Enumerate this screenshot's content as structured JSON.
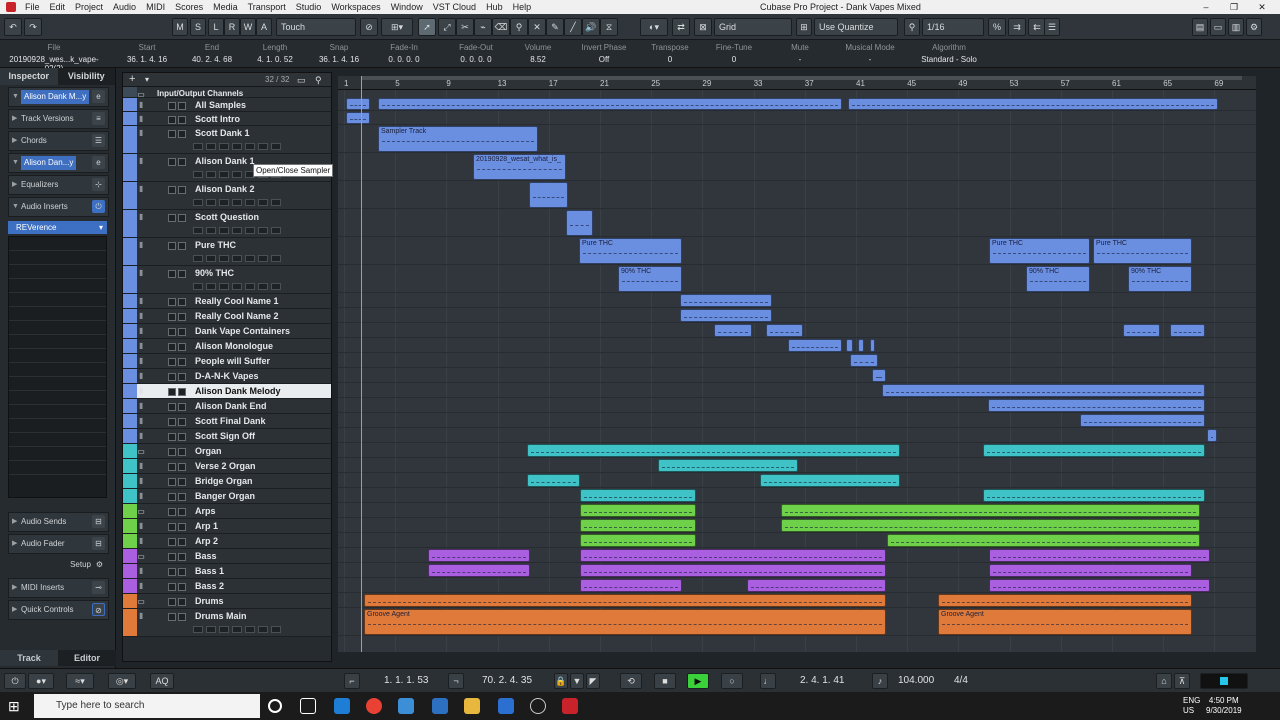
{
  "window": {
    "title": "Cubase Pro Project - Dank Vapes Mixed",
    "menus": [
      "File",
      "Edit",
      "Project",
      "Audio",
      "MIDI",
      "Scores",
      "Media",
      "Transport",
      "Studio",
      "Workspaces",
      "Window",
      "VST Cloud",
      "Hub",
      "Help"
    ]
  },
  "toolbar": {
    "m": "M",
    "s": "S",
    "l": "L",
    "r": "R",
    "w": "W",
    "a": "A",
    "automation_mode": "Touch",
    "grid_type": "Grid",
    "quantize_mode": "Use Quantize",
    "quantize_value": "1/16"
  },
  "infoline": [
    {
      "label": "File",
      "value": "20190928_wes...k_vape-02(2)"
    },
    {
      "label": "Start",
      "value": "36. 1. 4. 16"
    },
    {
      "label": "End",
      "value": "40. 2. 4. 68"
    },
    {
      "label": "Length",
      "value": "4. 1. 0. 52"
    },
    {
      "label": "Snap",
      "value": "36. 1. 4. 16"
    },
    {
      "label": "Fade-In",
      "value": "0. 0. 0. 0"
    },
    {
      "label": "Fade-Out",
      "value": "0. 0. 0. 0"
    },
    {
      "label": "Volume",
      "value": "8.52"
    },
    {
      "label": "Invert Phase",
      "value": "Off"
    },
    {
      "label": "Transpose",
      "value": "0"
    },
    {
      "label": "Fine-Tune",
      "value": "0"
    },
    {
      "label": "Mute",
      "value": "-"
    },
    {
      "label": "Musical Mode",
      "value": "-"
    },
    {
      "label": "Algorithm",
      "value": "Standard - Solo"
    }
  ],
  "inspector": {
    "tabs": [
      "Inspector",
      "Visibility"
    ],
    "track_name": "Alison Dank M...y",
    "track_versions": "Track Versions",
    "chords": "Chords",
    "sub_track": "Alison Dan...y",
    "equalizers": "Equalizers",
    "audio_inserts": "Audio Inserts",
    "insert_plugin": "REVerence",
    "audio_sends": "Audio Sends",
    "audio_fader": "Audio Fader",
    "setup": "Setup",
    "midi_inserts": "MIDI Inserts",
    "quick_controls": "Quick Controls",
    "bottom_tabs": [
      "Track",
      "Editor"
    ]
  },
  "tracklist": {
    "count": "32 / 32",
    "tooltip": "Open/Close Sampler"
  },
  "tracks": [
    {
      "name": "Input/Output Channels",
      "color": "#3d4a57"
    },
    {
      "name": "All Samples",
      "color": "#6b8fe0"
    },
    {
      "name": "Scott Intro",
      "color": "#6b8fe0"
    },
    {
      "name": "Scott Dank 1",
      "color": "#6b8fe0"
    },
    {
      "name": "Alison Dank 1",
      "color": "#6b8fe0"
    },
    {
      "name": "Alison Dank 2",
      "color": "#6b8fe0"
    },
    {
      "name": "Scott Question",
      "color": "#6b8fe0"
    },
    {
      "name": "Pure THC",
      "color": "#6b8fe0"
    },
    {
      "name": "90% THC",
      "color": "#6b8fe0"
    },
    {
      "name": "Really Cool Name 1",
      "color": "#6b8fe0"
    },
    {
      "name": "Really Cool Name 2",
      "color": "#6b8fe0"
    },
    {
      "name": "Dank Vape Containers",
      "color": "#6b8fe0"
    },
    {
      "name": "Alison Monologue",
      "color": "#6b8fe0"
    },
    {
      "name": "People will Suffer",
      "color": "#6b8fe0"
    },
    {
      "name": "D-A-N-K Vapes",
      "color": "#6b8fe0"
    },
    {
      "name": "Alison Dank Melody",
      "color": "#6b8fe0"
    },
    {
      "name": "Alison Dank End",
      "color": "#6b8fe0"
    },
    {
      "name": "Scott Final Dank",
      "color": "#6b8fe0"
    },
    {
      "name": "Scott Sign Off",
      "color": "#6b8fe0"
    },
    {
      "name": "Organ",
      "color": "#3fc3c6"
    },
    {
      "name": "Verse 2 Organ",
      "color": "#3fc3c6"
    },
    {
      "name": "Bridge Organ",
      "color": "#3fc3c6"
    },
    {
      "name": "Banger Organ",
      "color": "#3fc3c6"
    },
    {
      "name": "Arps",
      "color": "#6fd04a"
    },
    {
      "name": "Arp 1",
      "color": "#6fd04a"
    },
    {
      "name": "Arp 2",
      "color": "#6fd04a"
    },
    {
      "name": "Bass",
      "color": "#a95fe0"
    },
    {
      "name": "Bass 1",
      "color": "#a95fe0"
    },
    {
      "name": "Bass 2",
      "color": "#a95fe0"
    },
    {
      "name": "Drums",
      "color": "#e07a3a"
    },
    {
      "name": "Drums Main",
      "color": "#e07a3a"
    }
  ],
  "ruler": [
    "1",
    "5",
    "9",
    "13",
    "17",
    "21",
    "25",
    "29",
    "33",
    "37",
    "41",
    "45",
    "49",
    "53",
    "57",
    "61",
    "65",
    "69"
  ],
  "clip_labels": {
    "sampler": "Sampler Track",
    "file": "20190928_wesat_what_is_",
    "pure": "Pure THC",
    "ninety": "90% THC",
    "groove": "Groove Agent"
  },
  "transport": {
    "left_locator": "1. 1. 1. 53",
    "right_locator": "70. 2. 4. 35",
    "position": "2. 4. 1. 41",
    "tempo": "104.000",
    "signature": "4/4"
  },
  "taskbar": {
    "search_placeholder": "Type here to search",
    "time": "4:50 PM",
    "date": "9/30/2019",
    "lang": "ENG",
    "region": "US"
  }
}
